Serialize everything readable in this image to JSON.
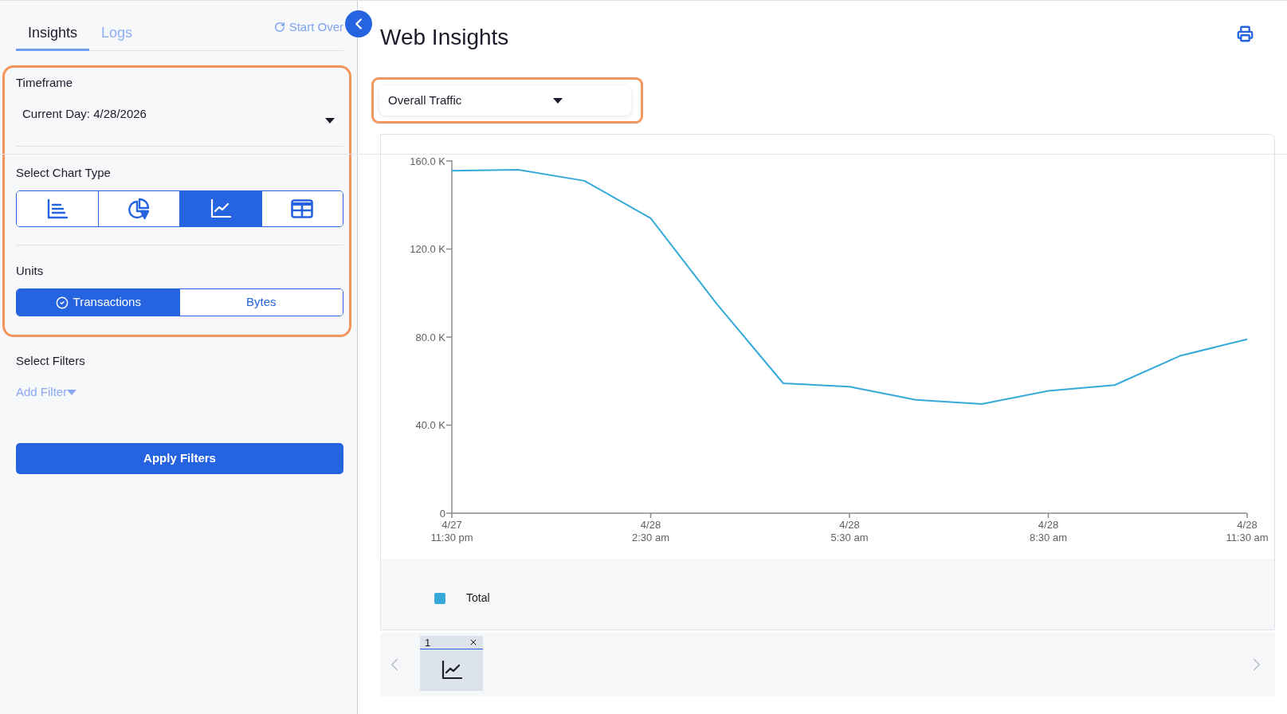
{
  "sidebar": {
    "tabs": [
      {
        "label": "Insights",
        "selected": true
      },
      {
        "label": "Logs",
        "selected": false
      }
    ],
    "start_over": "Start Over",
    "settings": {
      "highlighted": true,
      "timeframe": {
        "label": "Timeframe",
        "value": "Current Day: 4/28/2026"
      },
      "chart_type": {
        "label": "Select Chart Type",
        "options": [
          {
            "kind": "bar",
            "selected": false
          },
          {
            "kind": "pie",
            "selected": false
          },
          {
            "kind": "line",
            "selected": true
          },
          {
            "kind": "table",
            "selected": false
          }
        ]
      },
      "units": {
        "label": "Units",
        "options": [
          {
            "label": "Transactions",
            "selected": true
          },
          {
            "label": "Bytes",
            "selected": false
          }
        ]
      }
    },
    "filters": {
      "label": "Select Filters",
      "add_filter": "Add Filter"
    },
    "apply_button": "Apply Filters"
  },
  "main": {
    "title": "Web Insights",
    "view_select": {
      "value": "Overall Traffic",
      "highlighted": true
    },
    "chart": {
      "chart_data": {
        "type": "line",
        "categories": [
          "4/27\n11:30 pm",
          null,
          null,
          "4/28\n2:30 am",
          null,
          null,
          "4/28\n5:30 am",
          null,
          null,
          "4/28\n8:30 am",
          null,
          null,
          "4/28\n11:30 am"
        ],
        "series": [
          {
            "name": "Total",
            "color": "#35a9d8",
            "values": [
              155600,
              156000,
              151000,
              134000,
              95000,
              59000,
              57500,
              51500,
              49600,
              55600,
              58200,
              71600,
              79000
            ]
          }
        ],
        "ylim": [
          0,
          160000
        ],
        "yticks": [
          {
            "value": 0,
            "label": "0"
          },
          {
            "value": 40000,
            "label": "40.0 K"
          },
          {
            "value": 80000,
            "label": "80.0 K"
          },
          {
            "value": 120000,
            "label": "120.0 K"
          },
          {
            "value": 160000,
            "label": "160.0 K"
          }
        ]
      }
    },
    "thumbnails": [
      {
        "label": "1",
        "kind": "line",
        "selected": true
      }
    ]
  }
}
